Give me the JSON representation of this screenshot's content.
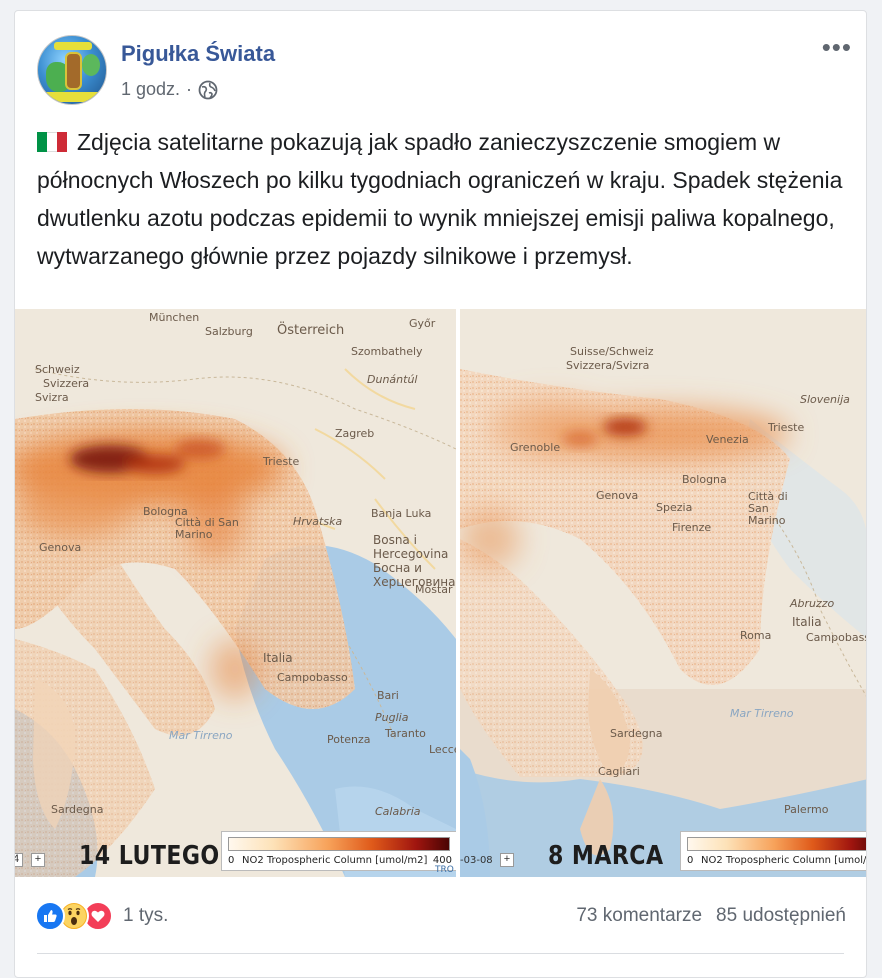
{
  "post": {
    "page_name": "Pigułka Świata",
    "time": "1 godz.",
    "separator": "·",
    "audience_icon": "globe-icon",
    "more_icon": "more-options-icon",
    "more_label": "•••",
    "flag_icon": "italy-flag-icon",
    "text": "Zdjęcia satelitarne pokazują jak spadło zanieczyszczenie smogiem w północnych Włoszech po kilku tygodniach ograniczeń w kraju. Spadek stężenia dwutlenku azotu podczas epidemii to wynik mniejszej emisji paliwa kopalnego, wytwarzanego głównie przez pojazdy silnikowe i przemysł."
  },
  "image": {
    "left_panel": {
      "label": "14 LUTEGO",
      "legend_min": "0",
      "legend_title": "NO2 Tropospheric Column [umol/m2]",
      "legend_max": "400",
      "zoom_minus": "4",
      "zoom_plus": "+",
      "attribution": "TRO",
      "places": [
        "München",
        "Salzburg",
        "Österreich",
        "Győr",
        "Szombathely",
        "Schweiz",
        "Svizzera",
        "Svizra",
        "Dunántúl",
        "Zagreb",
        "Trieste",
        "Bologna",
        "Città di San Marino",
        "Hrvatska",
        "Banja Luka",
        "Bosna i Hercegovina",
        "Босна и Херцеговина",
        "Mostar",
        "Genova",
        "Italia",
        "Campobasso",
        "Bari",
        "Puglia",
        "Taranto",
        "Lecce",
        "Potenza",
        "Mar Tirreno",
        "Sardegna",
        "Calabria"
      ]
    },
    "right_panel": {
      "label": "8 MARCA",
      "legend_min": "0",
      "legend_title": "NO2 Tropospheric Column [umol/m",
      "zoom_minus": "-03-08",
      "zoom_plus": "+",
      "places": [
        "Suisse/Schweiz",
        "Svizzera/Svizra",
        "Venezia",
        "Trieste",
        "Slovenija",
        "Grenoble",
        "Genova",
        "Bologna",
        "Spezia",
        "Firenze",
        "Città di San Marino",
        "Italia",
        "Abruzzo",
        "Campobasso",
        "Roma",
        "Mar Tirreno",
        "Sardegna",
        "Cagliari",
        "Palermo"
      ]
    },
    "colors": {
      "map_base": "#efe8dc",
      "sea": "#aacbe6",
      "plume_light": "#f6c79a",
      "plume_mid": "#e8823a",
      "plume_dark": "#7a1a0a"
    }
  },
  "stats": {
    "reactions": [
      "like-icon",
      "wow-icon",
      "love-icon"
    ],
    "reaction_count": "1 tys.",
    "comments": "73 komentarze",
    "shares": "85 udostępnień"
  }
}
